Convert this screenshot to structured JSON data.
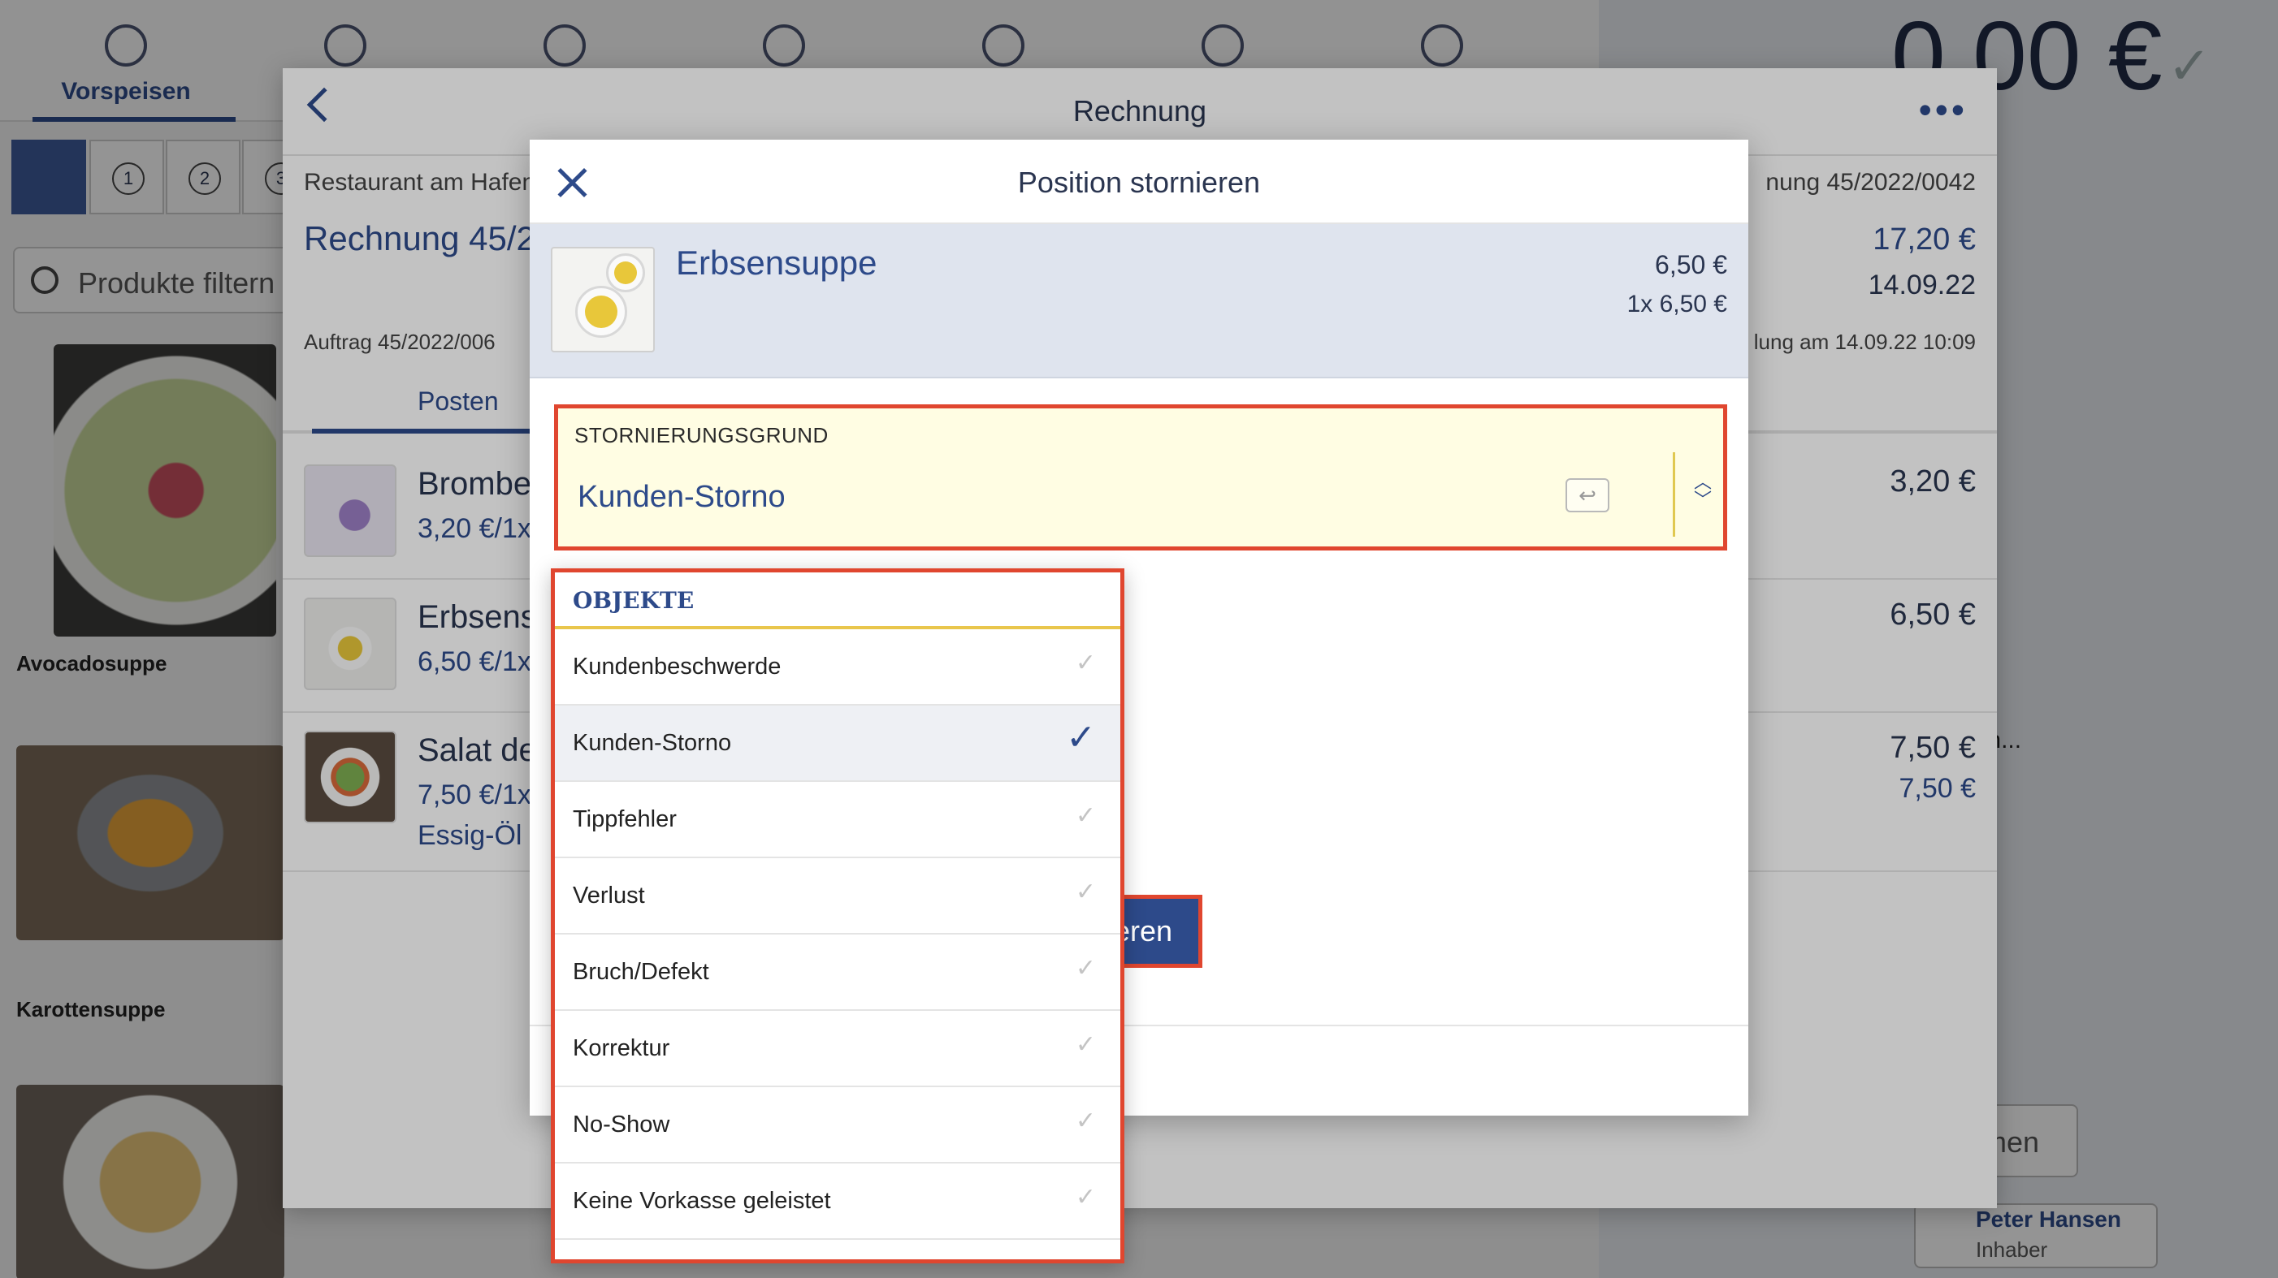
{
  "background": {
    "tabs": [
      {
        "label": "Vorspeisen",
        "active": true
      },
      {
        "label": ""
      },
      {
        "label": ""
      },
      {
        "label": ""
      },
      {
        "label": ""
      },
      {
        "label": ""
      },
      {
        "label": ""
      }
    ],
    "filter_buttons": [
      "1",
      "2",
      "3"
    ],
    "search_placeholder": "Produkte filtern",
    "products": [
      "Avocadosuppe",
      "Karottensuppe"
    ],
    "cart_total": "0,00 €",
    "cart_footer_partial": "ehmen",
    "cart_user": {
      "name": "Peter Hansen",
      "role": "Inhaber"
    },
    "cart_select_partial": "wählen..."
  },
  "invoice": {
    "title": "Rechnung",
    "restaurant": "Restaurant am Hafen",
    "number_partial": "Rechnung 45/2",
    "number_right_partial": "nung 45/2022/0042",
    "total": "17,20 €",
    "date": "14.09.22",
    "order_partial": "Auftrag 45/2022/006",
    "payment_partial": "lung am 14.09.22 10:09",
    "tab_label": "Posten",
    "rows": [
      {
        "name": "Brombe",
        "sub": "3,20 €/1x",
        "price": "3,20 €",
        "extra": ""
      },
      {
        "name": "Erbsens",
        "sub": "6,50 €/1x",
        "price": "6,50 €",
        "extra": ""
      },
      {
        "name": "Salat de",
        "sub": "7,50 €/1x",
        "price": "7,50 €",
        "extra": "Essig-Öl",
        "price2": "7,50 €"
      }
    ]
  },
  "modal": {
    "title": "Position stornieren",
    "item": {
      "name": "Erbsensuppe",
      "price": "6,50 €",
      "qty_line": "1x 6,50 €"
    },
    "reason_label": "STORNIERUNGSGRUND",
    "reason_value": "Kunden-Storno",
    "submit_label": "Stornieren"
  },
  "dropdown": {
    "header": "OBJEKTE",
    "options": [
      {
        "label": "Kundenbeschwerde",
        "selected": false
      },
      {
        "label": "Kunden-Storno",
        "selected": true
      },
      {
        "label": "Tippfehler",
        "selected": false
      },
      {
        "label": "Verlust",
        "selected": false
      },
      {
        "label": "Bruch/Defekt",
        "selected": false
      },
      {
        "label": "Korrektur",
        "selected": false
      },
      {
        "label": "No-Show",
        "selected": false
      },
      {
        "label": "Keine Vorkasse geleistet",
        "selected": false
      }
    ]
  },
  "colors": {
    "accent": "#2d4a8a",
    "highlight_border": "#e0462f",
    "reason_bg": "#fffde3",
    "item_bg": "#dfe4ee"
  },
  "icons": {
    "close": "close-icon",
    "back": "chevron-left-icon",
    "more": "more-icon",
    "enter": "enter-key-icon",
    "spinner": "up-down-chevron-icon",
    "check": "check-icon"
  }
}
